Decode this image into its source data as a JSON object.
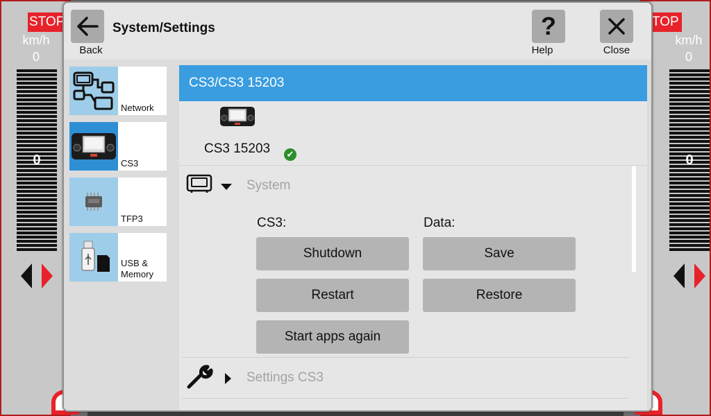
{
  "throttle_left": {
    "stop": "STOP",
    "unit": "km/h",
    "speed": "0",
    "gauge_value": "0"
  },
  "throttle_right": {
    "stop": "STOP",
    "unit": "km/h",
    "speed": "0",
    "gauge_value": "0"
  },
  "header": {
    "title": "System/Settings",
    "back_label": "Back",
    "help_label": "Help",
    "close_label": "Close"
  },
  "nav": {
    "items": [
      {
        "label": "Network",
        "icon": "network-icon"
      },
      {
        "label": "CS3",
        "icon": "cs3-device-icon",
        "active": true
      },
      {
        "label": "TFP3",
        "icon": "tfp3-chip-icon"
      },
      {
        "label": "USB &\nMemory",
        "icon": "usb-memory-icon"
      }
    ]
  },
  "panel": {
    "title": "CS3/CS3 15203",
    "device_name": "CS3 15203",
    "status": "ok",
    "system_section": {
      "title": "System",
      "cs3_label": "CS3:",
      "data_label": "Data:",
      "buttons": {
        "shutdown": "Shutdown",
        "restart": "Restart",
        "start_apps": "Start apps again",
        "save": "Save",
        "restore": "Restore"
      }
    },
    "settings_section": {
      "title": "Settings CS3"
    }
  },
  "colors": {
    "accent": "#3a9de0",
    "stop": "#e8222a",
    "button": "#b4b4b4"
  }
}
